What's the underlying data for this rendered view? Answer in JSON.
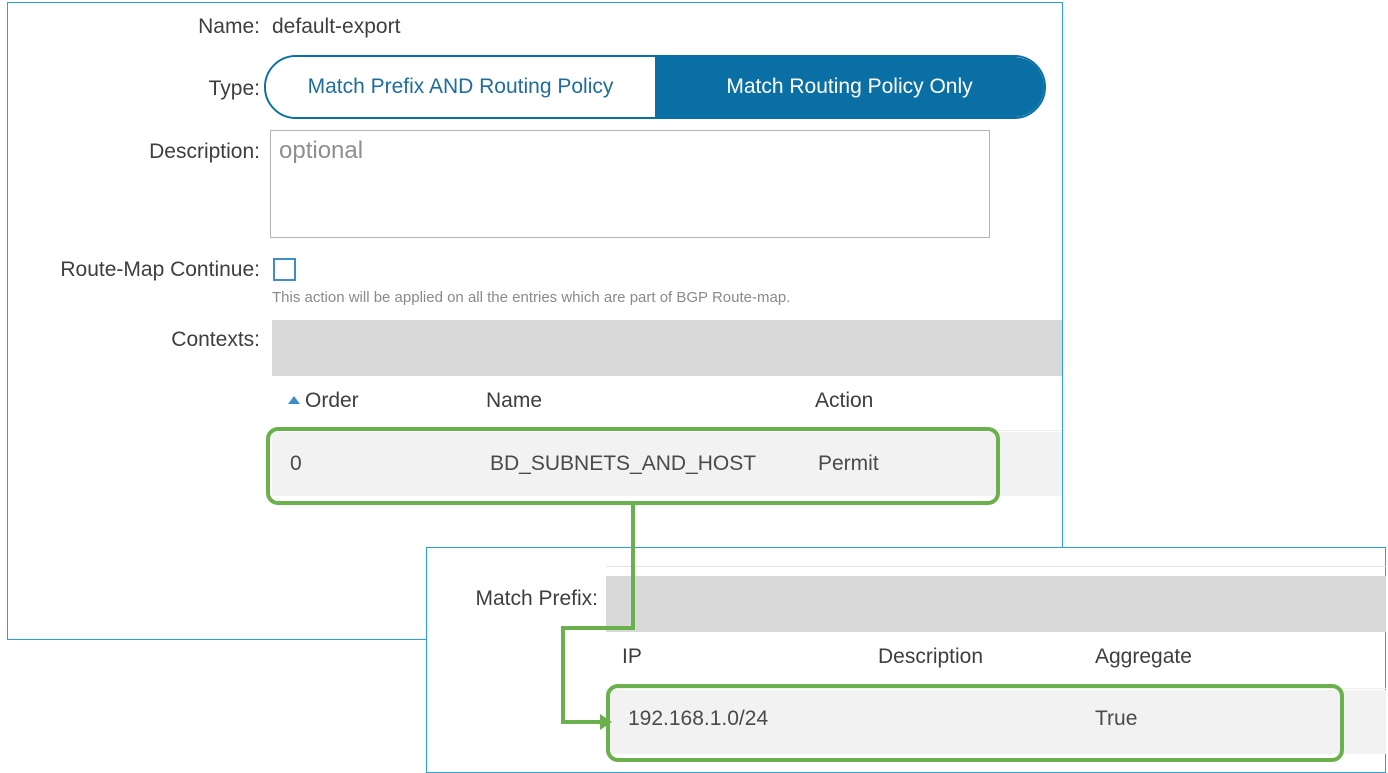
{
  "policy": {
    "name_label": "Name:",
    "name_value": "default-export",
    "type_label": "Type:",
    "type_options": [
      "Match Prefix AND Routing Policy",
      "Match Routing Policy Only"
    ],
    "type_selected": "Match Routing Policy Only",
    "description_label": "Description:",
    "description_placeholder": "optional",
    "route_map_label": "Route-Map Continue:",
    "route_map_checked": false,
    "route_map_hint": "This action will be applied on all the entries which are part of BGP Route-map.",
    "contexts_label": "Contexts:"
  },
  "contexts_table": {
    "headers": [
      "Order",
      "Name",
      "Action"
    ],
    "rows": [
      {
        "order": "0",
        "name": "BD_SUBNETS_AND_HOST",
        "action": "Permit"
      }
    ]
  },
  "match_prefix": {
    "label": "Match Prefix:",
    "headers": [
      "IP",
      "Description",
      "Aggregate"
    ],
    "rows": [
      {
        "ip": "192.168.1.0/24",
        "description": "",
        "aggregate": "True"
      }
    ]
  },
  "colors": {
    "accent": "#0a6fa4",
    "highlight": "#6ab04c",
    "panel_border": "#27a3d8"
  },
  "icons": {
    "sort": "sort-ascending-icon",
    "connector": "arrow-right-icon"
  }
}
